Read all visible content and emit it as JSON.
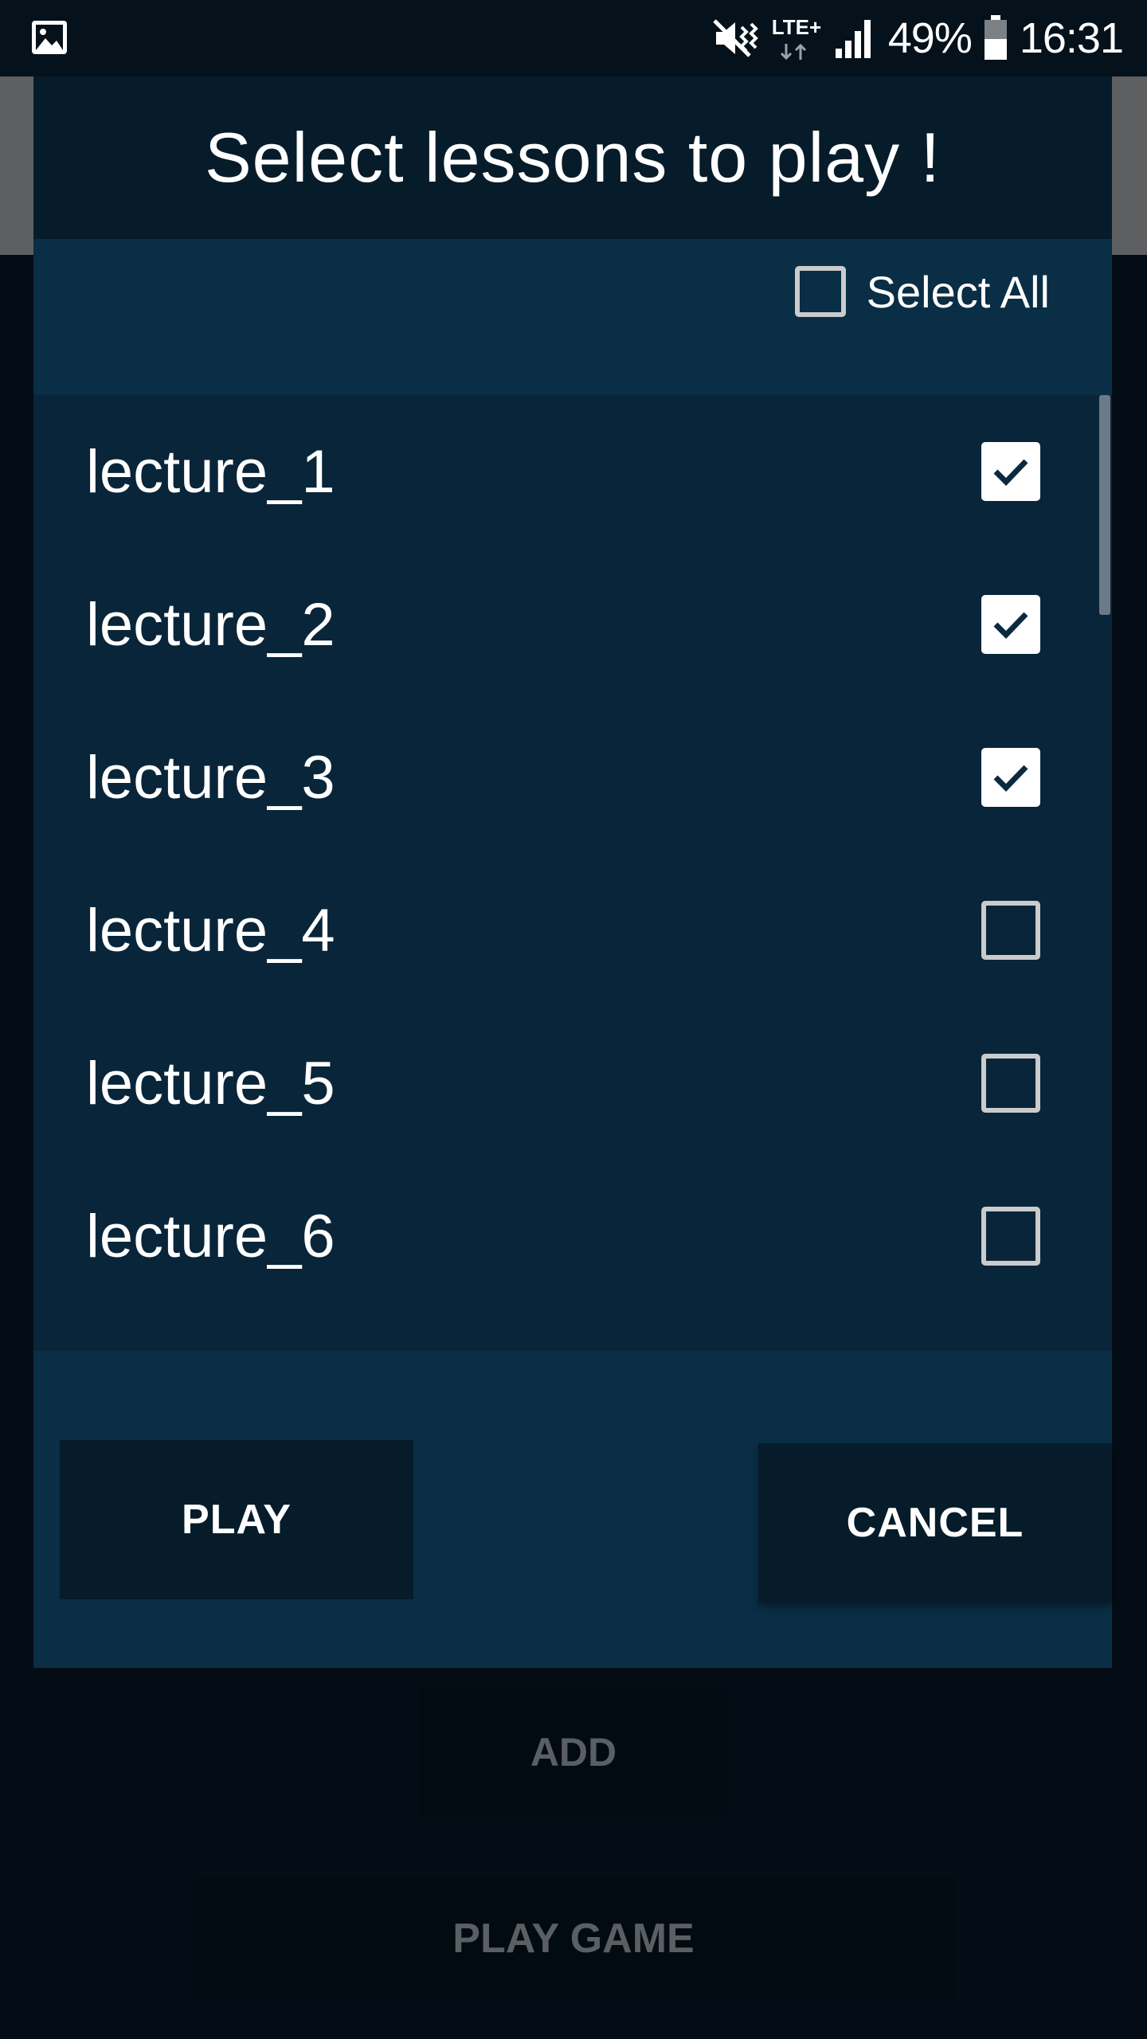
{
  "status_bar": {
    "battery_percent": "49%",
    "time": "16:31",
    "network_type": "LTE+",
    "icons": [
      "gallery-icon",
      "mute-vibrate-icon",
      "lte-data-icon",
      "signal-icon",
      "battery-icon"
    ]
  },
  "dialog": {
    "title": "Select lessons to play !",
    "select_all": {
      "label": "Select All",
      "checked": false
    },
    "lessons": [
      {
        "label": "lecture_1",
        "checked": true
      },
      {
        "label": "lecture_2",
        "checked": true
      },
      {
        "label": "lecture_3",
        "checked": true
      },
      {
        "label": "lecture_4",
        "checked": false
      },
      {
        "label": "lecture_5",
        "checked": false
      },
      {
        "label": "lecture_6",
        "checked": false
      }
    ],
    "play_label": "PLAY",
    "cancel_label": "CANCEL"
  },
  "background_screen": {
    "add_label": "ADD",
    "play_game_label": "PLAY GAME"
  },
  "colors": {
    "dialog_background": "#092e45",
    "list_background": "#09253a",
    "title_bar": "#061c2a",
    "disabled_text": "#5a5f63"
  }
}
